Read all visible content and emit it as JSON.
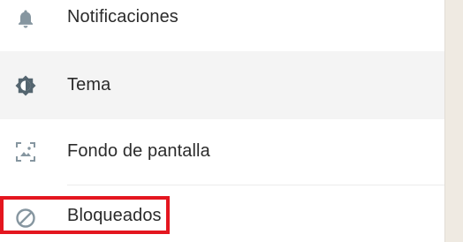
{
  "menu": {
    "items": [
      {
        "label": "Notificaciones",
        "icon": "bell-icon"
      },
      {
        "label": "Tema",
        "icon": "brightness-icon"
      },
      {
        "label": "Fondo de pantalla",
        "icon": "wallpaper-icon"
      },
      {
        "label": "Bloqueados",
        "icon": "block-icon"
      }
    ]
  },
  "colors": {
    "text": "#2b2b2b",
    "icon": "#8696a0",
    "hover_background": "#f4f4f4",
    "highlight_border": "#e4161f",
    "side_panel": "#efeae2"
  }
}
